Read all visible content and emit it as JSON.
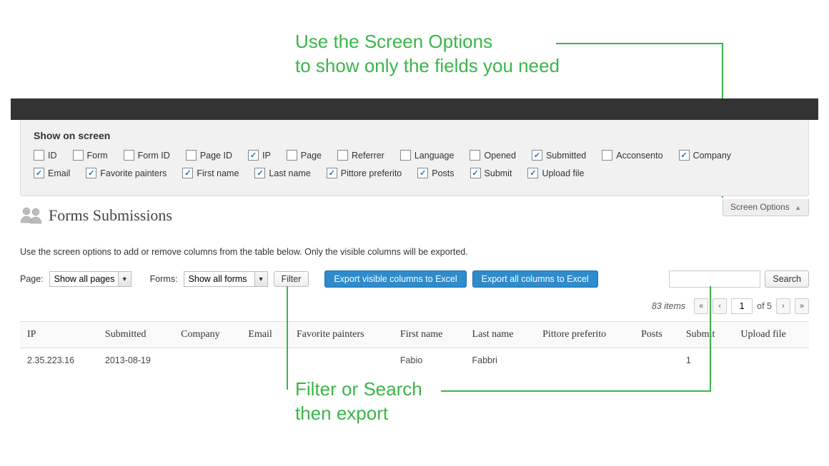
{
  "annotations": {
    "top_line1": "Use the Screen Options",
    "top_line2": "to show only the fields you need",
    "bottom_line1": "Filter or Search",
    "bottom_line2": "then export"
  },
  "screen_options": {
    "heading": "Show on screen",
    "tab_label": "Screen Options",
    "items": [
      {
        "label": "ID",
        "checked": false
      },
      {
        "label": "Form",
        "checked": false
      },
      {
        "label": "Form ID",
        "checked": false
      },
      {
        "label": "Page ID",
        "checked": false
      },
      {
        "label": "IP",
        "checked": true
      },
      {
        "label": "Page",
        "checked": false
      },
      {
        "label": "Referrer",
        "checked": false
      },
      {
        "label": "Language",
        "checked": false
      },
      {
        "label": "Opened",
        "checked": false
      },
      {
        "label": "Submitted",
        "checked": true
      },
      {
        "label": "Acconsento",
        "checked": false
      },
      {
        "label": "Company",
        "checked": true
      },
      {
        "label": "Email",
        "checked": true
      },
      {
        "label": "Favorite painters",
        "checked": true
      },
      {
        "label": "First name",
        "checked": true
      },
      {
        "label": "Last name",
        "checked": true
      },
      {
        "label": "Pittore preferito",
        "checked": true
      },
      {
        "label": "Posts",
        "checked": true
      },
      {
        "label": "Submit",
        "checked": true
      },
      {
        "label": "Upload file",
        "checked": true
      }
    ]
  },
  "page": {
    "title": "Forms Submissions",
    "hint": "Use the screen options to add or remove columns from the table below. Only the visible columns will be exported."
  },
  "filterbar": {
    "page_label": "Page:",
    "page_select": "Show all pages",
    "forms_label": "Forms:",
    "forms_select": "Show all forms",
    "filter_btn": "Filter",
    "export_visible": "Export visible columns to Excel",
    "export_all": "Export all columns to Excel",
    "search_btn": "Search"
  },
  "pagination": {
    "items_count": "83 items",
    "current": "1",
    "of_label": "of 5"
  },
  "table": {
    "headers": [
      "IP",
      "Submitted",
      "Company",
      "Email",
      "Favorite painters",
      "First name",
      "Last name",
      "Pittore preferito",
      "Posts",
      "Submit",
      "Upload file"
    ],
    "row": {
      "ip": "2.35.223.16",
      "submitted": "2013-08-19",
      "company": "",
      "email": "",
      "favorite_painters": "",
      "first_name": "Fabio",
      "last_name": "Fabbri",
      "pittore_preferito": "",
      "posts": "",
      "submit": "1",
      "upload_file": ""
    }
  }
}
